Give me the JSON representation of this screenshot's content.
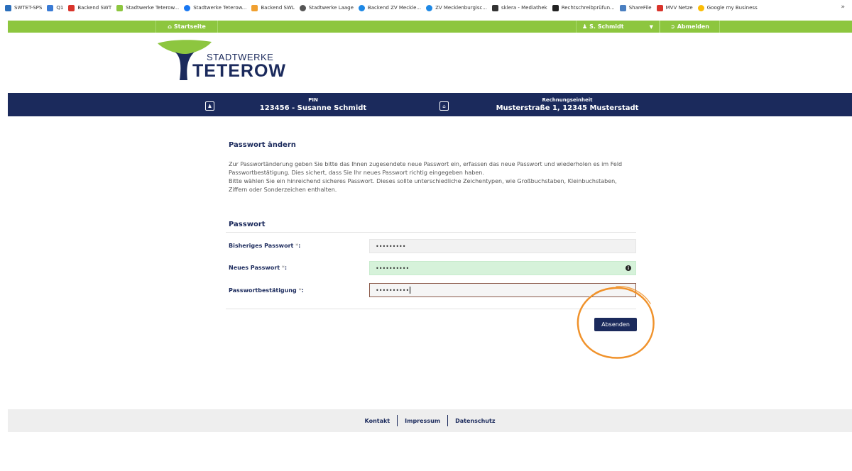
{
  "bookmarks": [
    {
      "label": "SWTET-SPS",
      "color": "#2a6ebb"
    },
    {
      "label": "Q1",
      "color": "#3a7bd5"
    },
    {
      "label": "Backend SWT",
      "color": "#d9342b"
    },
    {
      "label": "Stadtwerke Teterow...",
      "color": "#8dc63f"
    },
    {
      "label": "Stadtwerke Teterow...",
      "color": "#1877f2"
    },
    {
      "label": "Backend SWL",
      "color": "#f0a030"
    },
    {
      "label": "Stadtwerke Laage",
      "color": "#555555"
    },
    {
      "label": "Backend ZV Meckle...",
      "color": "#1e88e5"
    },
    {
      "label": "ZV Mecklenburgisc...",
      "color": "#1e88e5"
    },
    {
      "label": "sklera - Mediathek",
      "color": "#333333"
    },
    {
      "label": "Rechtschreibprüfun...",
      "color": "#222222"
    },
    {
      "label": "ShareFile",
      "color": "#4a7fc1"
    },
    {
      "label": "MVV Netze",
      "color": "#d9342b"
    },
    {
      "label": "Google my Business",
      "color": "#fbbc05"
    }
  ],
  "bookmarks_more": "»",
  "topbar": {
    "home_label": "Startseite",
    "user_label": "S. Schmidt",
    "logout_label": "Abmelden"
  },
  "logo": {
    "line1": "STADTWERKE",
    "line2": "TETEROW"
  },
  "infobar": {
    "pin_label": "PIN",
    "pin_value": "123456 - Susanne Schmidt",
    "unit_label": "Rechnungseinheit",
    "unit_value": "Musterstraße 1, 12345 Musterstadt"
  },
  "page": {
    "title": "Passwort ändern",
    "intro1": "Zur Passwortänderung geben Sie bitte das Ihnen zugesendete neue Passwort ein, erfassen das neue Passwort und wiederholen es im Feld Passwortbestätigung. Dies sichert, dass Sie Ihr neues Passwort richtig eingegeben haben.",
    "intro2": "Bitte wählen Sie ein hinreichend sicheres Passwort. Dieses sollte unterschiedliche Zeichentypen, wie Großbuchstaben, Kleinbuchstaben, Ziffern oder Sonderzeichen enthalten."
  },
  "form": {
    "section_title": "Passwort",
    "old_label": "Bisheriges Passwort",
    "old_value": "•••••••••",
    "new_label": "Neues Passwort",
    "new_value": "••••••••••",
    "confirm_label": "Passwortbestätigung",
    "confirm_value": "••••••••••",
    "required_mark": "*",
    "suffix": ":",
    "submit_label": "Absenden"
  },
  "footer": {
    "contact": "Kontakt",
    "imprint": "Impressum",
    "privacy": "Datenschutz"
  },
  "colors": {
    "green": "#8dc63f",
    "navy": "#1b2a5c",
    "annotation": "#f0922b"
  }
}
